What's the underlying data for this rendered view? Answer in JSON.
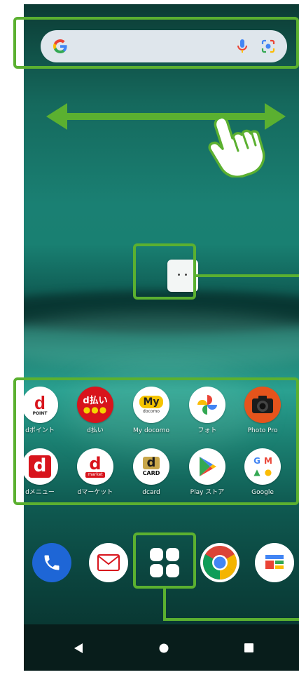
{
  "search": {
    "logo_letter": "G"
  },
  "apps": [
    {
      "id": "dpoint",
      "label": "dポイント",
      "icon_text": "d",
      "icon_sub": "POINT"
    },
    {
      "id": "dbarai",
      "label": "d払い",
      "icon_text": "d払い"
    },
    {
      "id": "mydocomo",
      "label": "My docomo",
      "icon_text": "My",
      "icon_sub": "docomo"
    },
    {
      "id": "photos",
      "label": "フォト"
    },
    {
      "id": "photopro",
      "label": "Photo Pro"
    },
    {
      "id": "dmenu",
      "label": "dメニュー",
      "icon_text": "d"
    },
    {
      "id": "dmarket",
      "label": "dマーケット",
      "icon_text": "d",
      "icon_sub": "market"
    },
    {
      "id": "dcard",
      "label": "dcard",
      "icon_text": "d",
      "icon_sub": "CARD"
    },
    {
      "id": "playstore",
      "label": "Play ストア"
    },
    {
      "id": "google",
      "label": "Google"
    }
  ],
  "dock": [
    {
      "id": "phone"
    },
    {
      "id": "mail"
    },
    {
      "id": "app-drawer"
    },
    {
      "id": "chrome"
    },
    {
      "id": "news"
    }
  ],
  "colors": {
    "highlight": "#5bb030",
    "docomo_red": "#d8141c",
    "mydocomo_yellow": "#f5c400",
    "phone_blue": "#1e66d6"
  },
  "icons": {
    "search": [
      "google-g-icon",
      "microphone-icon",
      "lens-camera-icon"
    ],
    "overlay": [
      "swipe-arrow-icon",
      "pointing-hand-icon"
    ],
    "nav": [
      "back-icon",
      "home-icon",
      "recents-icon"
    ]
  }
}
